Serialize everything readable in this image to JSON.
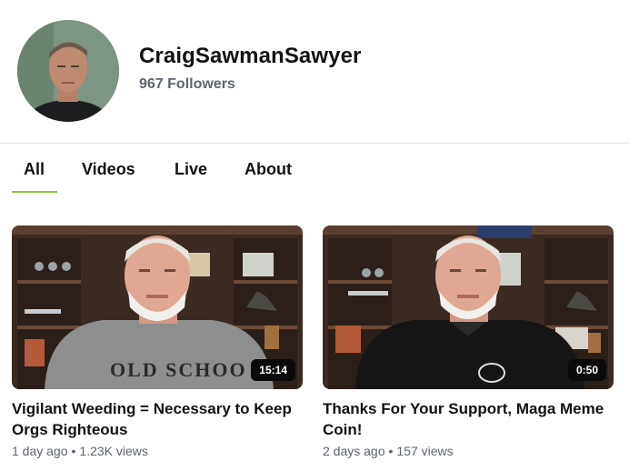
{
  "channel": {
    "name": "CraigSawmanSawyer",
    "followers": "967 Followers"
  },
  "tabs": [
    {
      "label": "All",
      "active": true
    },
    {
      "label": "Videos",
      "active": false
    },
    {
      "label": "Live",
      "active": false
    },
    {
      "label": "About",
      "active": false
    }
  ],
  "colors": {
    "accent": "#85c742",
    "meta_text": "#5c6370"
  },
  "videos": [
    {
      "title": "Vigilant Weeding = Necessary to Keep Orgs Righteous",
      "duration": "15:14",
      "age": "1 day ago",
      "views": "1.23K views",
      "shirt_text": "OLD SCHOO"
    },
    {
      "title": "Thanks For Your Support, Maga Meme Coin!",
      "duration": "0:50",
      "age": "2 days ago",
      "views": "157 views"
    }
  ]
}
